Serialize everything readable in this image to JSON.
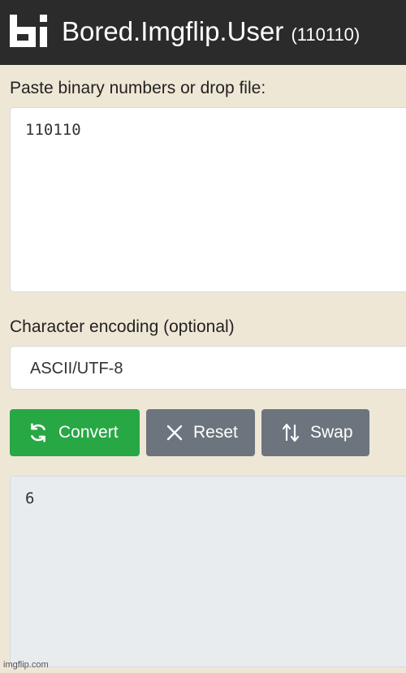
{
  "header": {
    "title": "Bored.Imgflip.User",
    "subtitle": "(110110)",
    "logo_icon": "bi-logo"
  },
  "input_section": {
    "label": "Paste binary numbers or drop file:",
    "value": "110110"
  },
  "encoding_section": {
    "label": "Character encoding (optional)",
    "selected": "ASCII/UTF-8"
  },
  "buttons": {
    "convert_label": "Convert",
    "reset_label": "Reset",
    "swap_label": "Swap"
  },
  "output": {
    "value": "6"
  },
  "watermark": "imgflip.com",
  "colors": {
    "header_bg": "#2b2b2b",
    "page_bg": "#efe7d6",
    "convert": "#28a745",
    "secondary": "#6c757d"
  }
}
